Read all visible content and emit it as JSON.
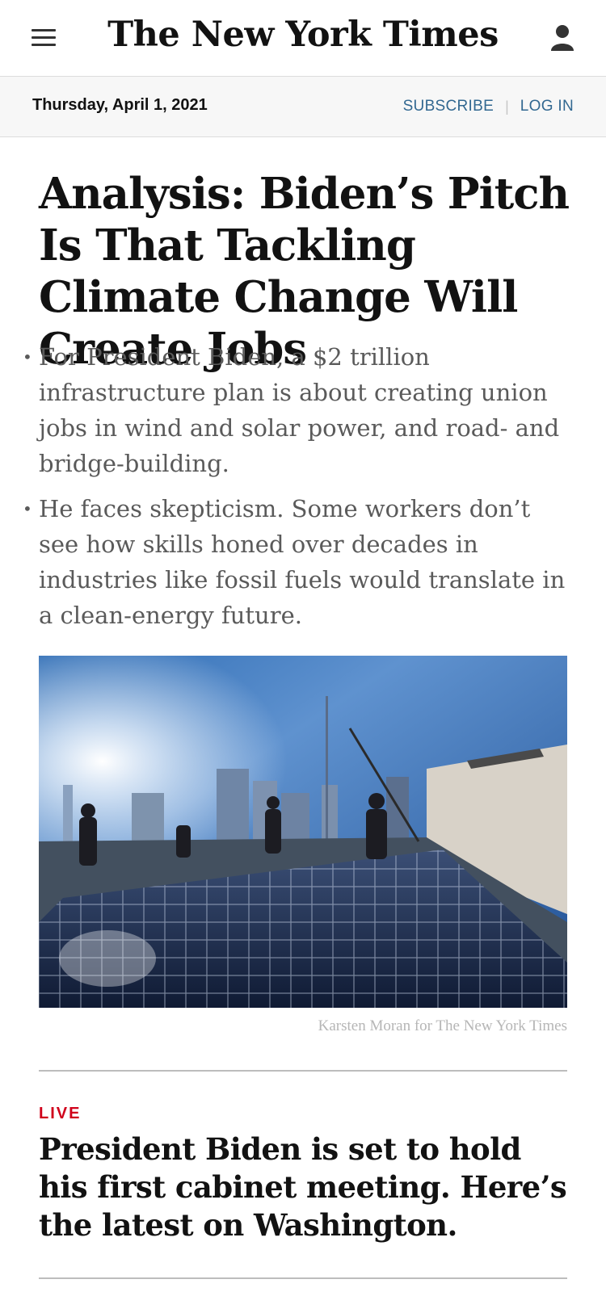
{
  "header": {
    "masthead": "The New York Times",
    "menu_icon": "hamburger-menu-icon",
    "account_icon": "person-icon"
  },
  "datebar": {
    "date": "Thursday, April 1, 2021",
    "subscribe": "SUBSCRIBE",
    "login": "LOG IN"
  },
  "article": {
    "headline": "Analysis: Biden’s Pitch Is That Tackling Climate Change Will Create Jobs",
    "summary": [
      "For President Biden, a $2 trillion infrastructure plan is about creating union jobs in wind and solar power, and road- and bridge-building.",
      "He faces skepticism. Some workers don’t see how skills honed over decades in industries like fossil fuels would translate in a clean-energy future."
    ],
    "photo_credit": "Karsten Moran for The New York Times"
  },
  "next_story": {
    "kicker": "LIVE",
    "headline": "President Biden is set to hold his first cabinet meeting. Here’s the latest on Washington."
  },
  "colors": {
    "link": "#326891",
    "live": "#d0021b",
    "summary_text": "#5a5a5a"
  }
}
